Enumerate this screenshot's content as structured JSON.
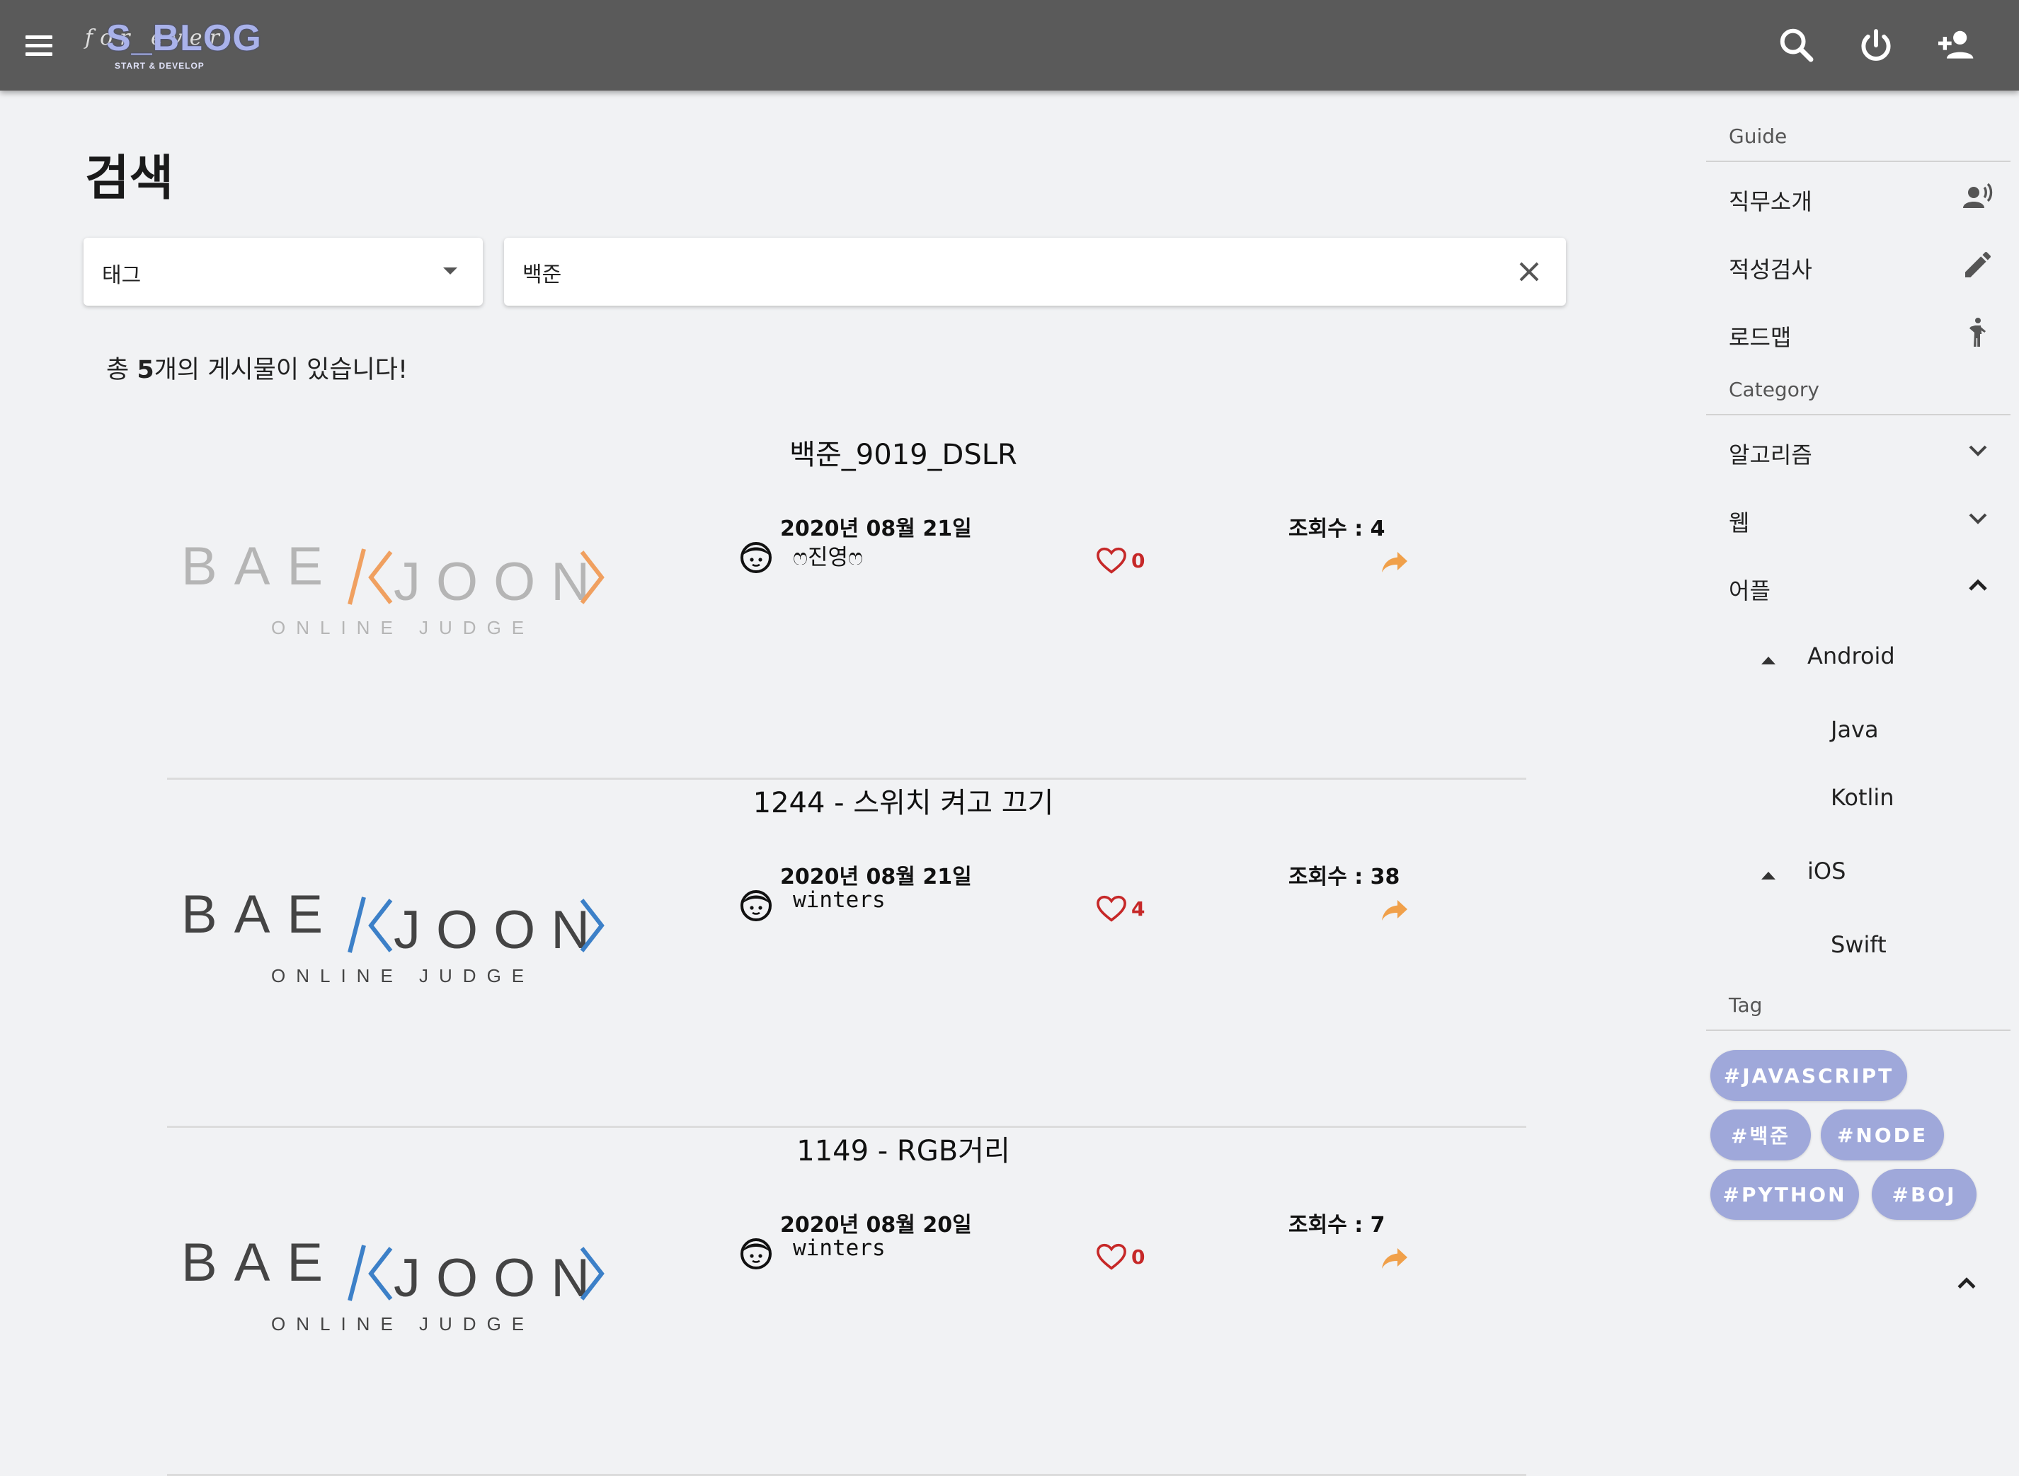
{
  "appbar": {
    "logo_main": "S_BLOG",
    "logo_script": "for ever",
    "logo_sub": "START & DEVELOP",
    "icons": [
      "menu-icon",
      "search-icon",
      "power-icon",
      "person-add-icon"
    ]
  },
  "page": {
    "title": "검색",
    "filter_value": "태그",
    "search_value": "백준",
    "count_prefix": "총 ",
    "count": "5",
    "count_suffix": "개의 게시물이 있습니다!"
  },
  "posts": [
    {
      "title": "백준_9019_DSLR",
      "date": "2020년 08월 21일",
      "views": "조회수 : 4",
      "author": "ෆ진영ෆ",
      "likes": "0",
      "thumb": {
        "word_left": "BAE",
        "word_right": "JOON",
        "sub": "ONLINE JUDGE",
        "accent": "#f0a060",
        "text_color": "#b5b5b5"
      }
    },
    {
      "title": "1244 - 스위치 켜고 끄기",
      "date": "2020년 08월 21일",
      "views": "조회수 : 38",
      "author": "winters",
      "likes": "4",
      "thumb": {
        "word_left": "BAE",
        "word_right": "JOON",
        "sub": "ONLINE JUDGE",
        "accent": "#3c80c8",
        "text_color": "#444444"
      }
    },
    {
      "title": "1149 - RGB거리",
      "date": "2020년 08월 20일",
      "views": "조회수 : 7",
      "author": "winters",
      "likes": "0",
      "thumb": {
        "word_left": "BAE",
        "word_right": "JOON",
        "sub": "ONLINE JUDGE",
        "accent": "#3c80c8",
        "text_color": "#444444"
      }
    }
  ],
  "sidebar": {
    "guide_header": "Guide",
    "guide_items": [
      {
        "label": "직무소개",
        "icon": "record-voice-icon"
      },
      {
        "label": "적성검사",
        "icon": "pencil-icon"
      },
      {
        "label": "로드맵",
        "icon": "walking-person-icon"
      }
    ],
    "category_header": "Category",
    "categories": [
      {
        "label": "알고리즘",
        "expanded": false
      },
      {
        "label": "웹",
        "expanded": false
      },
      {
        "label": "어플",
        "expanded": true
      }
    ],
    "sub_groups": [
      {
        "label": "Android",
        "children": [
          "Java",
          "Kotlin"
        ]
      },
      {
        "label": "iOS",
        "children": [
          "Swift"
        ]
      }
    ],
    "tag_header": "Tag",
    "tags": [
      "#JAVASCRIPT",
      "#백준",
      "#NODE",
      "#PYTHON",
      "#BOJ"
    ]
  },
  "colors": {
    "appbar": "#5a5a5a",
    "background": "#f1f2f4",
    "chip": "#9fa8da",
    "like": "#c62828",
    "share": "#f0a04a"
  }
}
